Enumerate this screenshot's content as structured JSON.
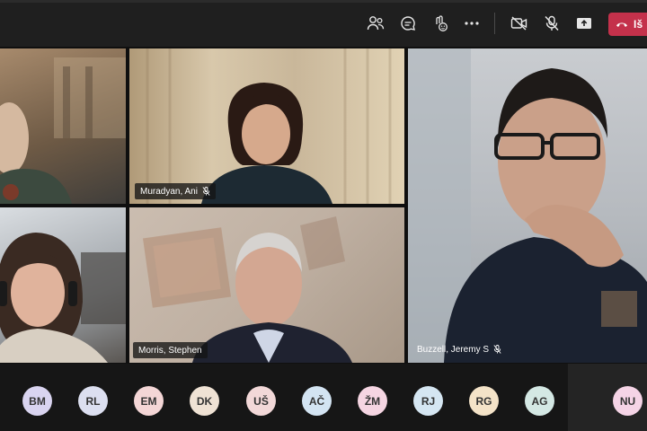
{
  "toolbar": {
    "leave_label": "Iš",
    "icons": [
      "people-icon",
      "chat-icon",
      "reactions-icon",
      "more-icon",
      "camera-off-icon",
      "mic-off-icon",
      "share-icon",
      "phone-icon"
    ],
    "leave_color": "#c4314b"
  },
  "tiles": [
    {
      "id": "top-left",
      "name": ""
    },
    {
      "id": "muradyan",
      "name": "Muradyan, Ani",
      "muted": true
    },
    {
      "id": "buzzell",
      "name": "Buzzell, Jeremy S",
      "muted": true
    },
    {
      "id": "bottom-left",
      "name": ""
    },
    {
      "id": "morris",
      "name": "Morris, Stephen",
      "muted": false
    }
  ],
  "participants": [
    {
      "initials": "BM",
      "color": "#d9d4f0"
    },
    {
      "initials": "RL",
      "color": "#dcdff0"
    },
    {
      "initials": "EM",
      "color": "#f4d6d6"
    },
    {
      "initials": "DK",
      "color": "#efe2d4"
    },
    {
      "initials": "UŠ",
      "color": "#f2d8d8"
    },
    {
      "initials": "AČ",
      "color": "#d3e4f2"
    },
    {
      "initials": "ŽM",
      "color": "#f5d5e2"
    },
    {
      "initials": "RJ",
      "color": "#d5e6f2"
    },
    {
      "initials": "RG",
      "color": "#f4e3c8"
    },
    {
      "initials": "AG",
      "color": "#d4e8e4"
    },
    {
      "initials": "NU",
      "color": "#f5d4e6"
    }
  ]
}
